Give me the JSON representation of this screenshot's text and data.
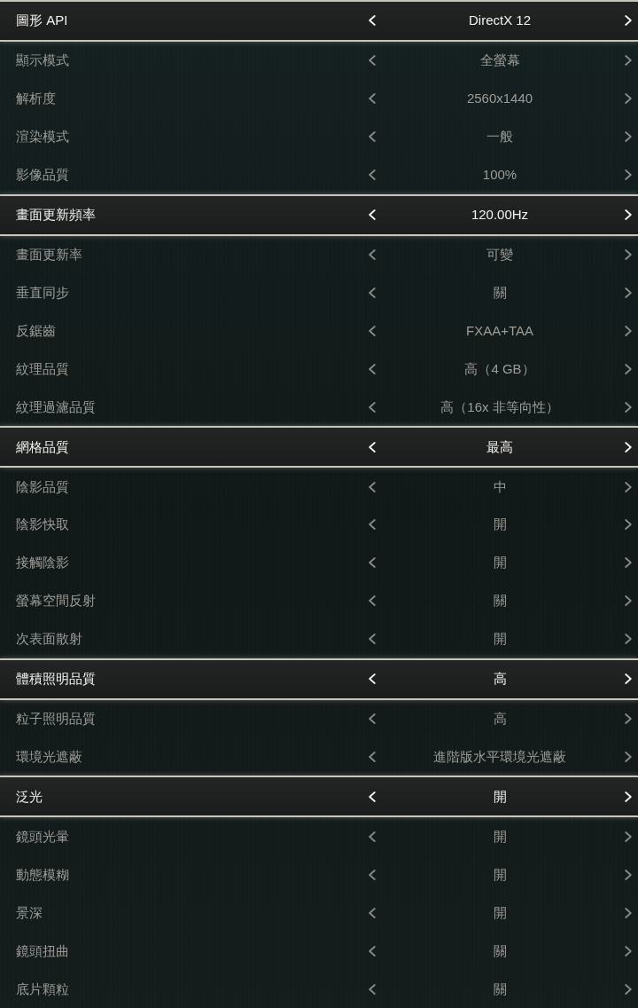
{
  "settings": [
    {
      "label": "圖形 API",
      "value": "DirectX 12",
      "selected": true
    },
    {
      "label": "顯示模式",
      "value": "全螢幕",
      "selected": false
    },
    {
      "label": "解析度",
      "value": "2560x1440",
      "selected": false
    },
    {
      "label": "渲染模式",
      "value": "一般",
      "selected": false
    },
    {
      "label": "影像品質",
      "value": "100%",
      "selected": false
    },
    {
      "label": "畫面更新頻率",
      "value": "120.00Hz",
      "selected": true
    },
    {
      "label": "畫面更新率",
      "value": "可變",
      "selected": false
    },
    {
      "label": "垂直同步",
      "value": "關",
      "selected": false
    },
    {
      "label": "反鋸齒",
      "value": "FXAA+TAA",
      "selected": false
    },
    {
      "label": "紋理品質",
      "value": "高（4 GB）",
      "selected": false
    },
    {
      "label": "紋理過濾品質",
      "value": "高（16x 非等向性）",
      "selected": false
    },
    {
      "label": "網格品質",
      "value": "最高",
      "selected": true
    },
    {
      "label": "陰影品質",
      "value": "中",
      "selected": false
    },
    {
      "label": "陰影快取",
      "value": "開",
      "selected": false
    },
    {
      "label": "接觸陰影",
      "value": "開",
      "selected": false
    },
    {
      "label": "螢幕空間反射",
      "value": "關",
      "selected": false
    },
    {
      "label": "次表面散射",
      "value": "開",
      "selected": false
    },
    {
      "label": "體積照明品質",
      "value": "高",
      "selected": true
    },
    {
      "label": "粒子照明品質",
      "value": "高",
      "selected": false
    },
    {
      "label": "環境光遮蔽",
      "value": "進階版水平環境光遮蔽",
      "selected": false
    },
    {
      "label": "泛光",
      "value": "開",
      "selected": true
    },
    {
      "label": "鏡頭光暈",
      "value": "開",
      "selected": false
    },
    {
      "label": "動態模糊",
      "value": "開",
      "selected": false
    },
    {
      "label": "景深",
      "value": "開",
      "selected": false
    },
    {
      "label": "鏡頭扭曲",
      "value": "關",
      "selected": false
    },
    {
      "label": "底片顆粒",
      "value": "關",
      "selected": false
    }
  ]
}
